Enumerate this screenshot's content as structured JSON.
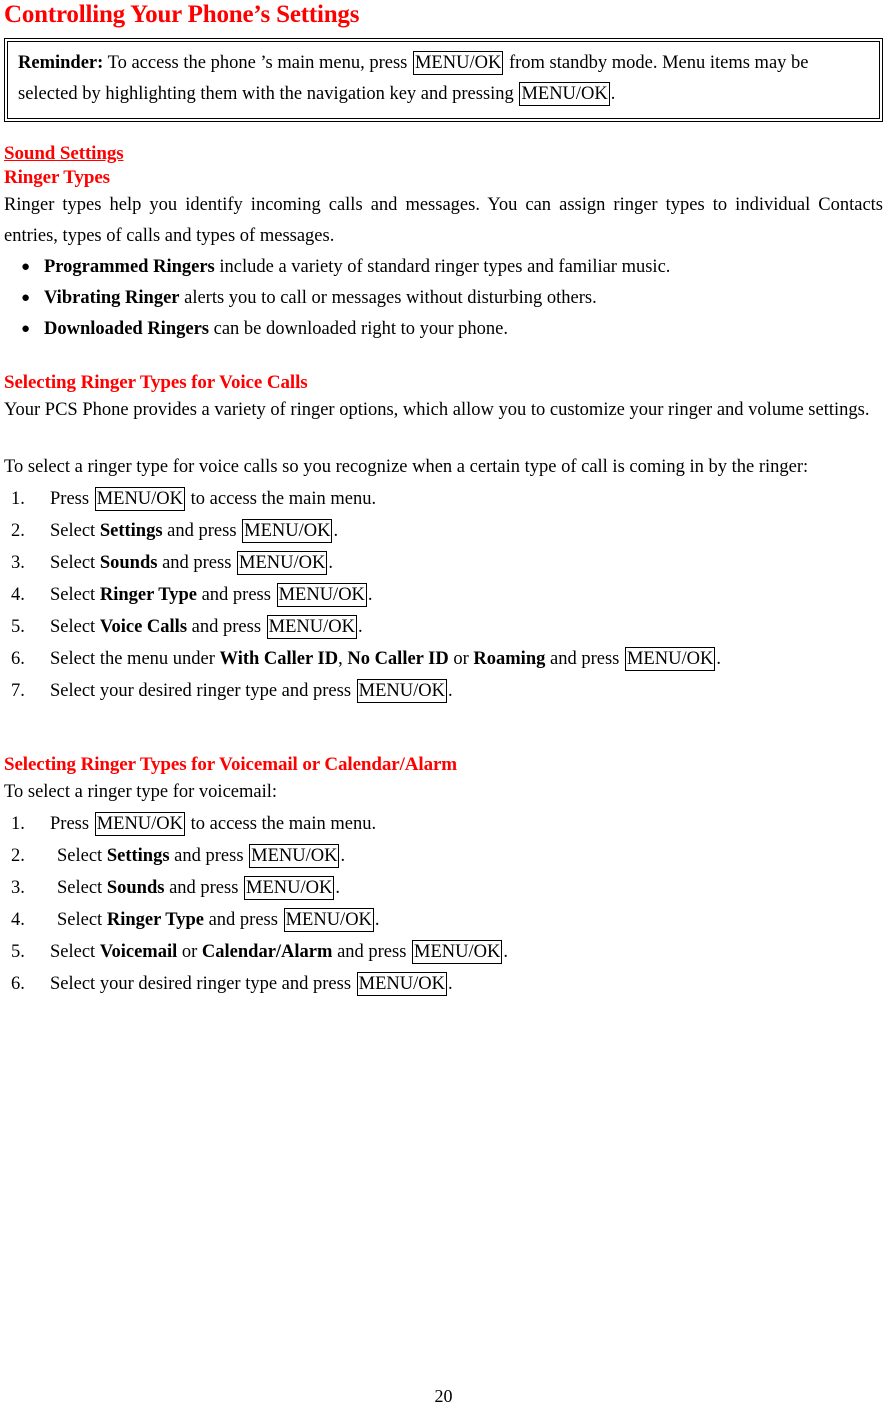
{
  "document": {
    "title": "Controlling Your Phone’s Settings",
    "page_number": "20",
    "accent_color": "#FF0000",
    "text_color": "#000000"
  },
  "reminder": {
    "label": "Reminder:",
    "part1": " To access the phone ’s main menu, press ",
    "key1": "MENU/OK",
    "part2": " from standby mode. Menu items may be selected by highlighting them with the navigation key and pressing ",
    "key2": "MENU/OK",
    "part3": "."
  },
  "sound_settings": {
    "heading": "Sound Settings",
    "ringer_types": {
      "heading": "Ringer Types",
      "intro": "Ringer types help you identify incoming calls and messages. You can assign ringer types to individual Contacts entries, types of calls and types of messages.",
      "bullets": [
        {
          "bullet": "●",
          "bold": "Programmed Ringers",
          "rest": " include a variety of standard ringer types and familiar music."
        },
        {
          "bullet": "●",
          "bold": "Vibrating Ringer",
          "rest": " alerts you to call or messages without disturbing others."
        },
        {
          "bullet": "●",
          "bold": "Downloaded Ringers",
          "rest": " can be downloaded right to your phone."
        }
      ]
    }
  },
  "voice_calls_section": {
    "heading": "Selecting Ringer Types for Voice Calls",
    "paragraph": "Your PCS Phone provides a variety of ringer options, which allow you to customize your ringer and volume settings.",
    "lead_in": "To select a ringer type for voice calls so you recognize when a certain type of call is coming in by the ringer:",
    "steps": [
      {
        "num": "1.",
        "pre": "Press ",
        "key": "MENU/OK",
        "post": " to access the main menu."
      },
      {
        "num": "2.",
        "pre": "Select ",
        "bold1": "Settings",
        "mid": " and press ",
        "key": "MENU/OK",
        "post": "."
      },
      {
        "num": "3.",
        "pre": "Select ",
        "bold1": "Sounds",
        "mid": " and press ",
        "key": "MENU/OK",
        "post": "."
      },
      {
        "num": "4.",
        "pre": "Select ",
        "bold1": "Ringer Type",
        "mid": " and press ",
        "key": "MENU/OK",
        "post": "."
      },
      {
        "num": "5.",
        "pre": "Select ",
        "bold1": "Voice Calls",
        "mid": " and press ",
        "key": "MENU/OK",
        "post": "."
      },
      {
        "num": "6.",
        "pre": "Select the menu under ",
        "bold1": "With Caller ID",
        "sep1": ", ",
        "bold2": "No Caller ID",
        "sep2": " or ",
        "bold3": "Roaming",
        "mid": " and press ",
        "key": "MENU/OK",
        "post": "."
      },
      {
        "num": "7.",
        "pre": "Select your desired ringer type and press ",
        "key": "MENU/OK",
        "post": "."
      }
    ]
  },
  "voicemail_section": {
    "heading": "Selecting Ringer Types for Voicemail or Calendar/Alarm",
    "lead_in": "To select a ringer type for voicemail:",
    "steps": [
      {
        "num": "1.",
        "pre": "Press ",
        "key": "MENU/OK",
        "post": " to access the main menu."
      },
      {
        "num": "2.",
        "pre": "Select ",
        "bold1": "Settings",
        "mid": " and press ",
        "key": "MENU/OK",
        "post": "."
      },
      {
        "num": "3.",
        "pre": "Select ",
        "bold1": "Sounds",
        "mid": " and press ",
        "key": "MENU/OK",
        "post": "."
      },
      {
        "num": "4.",
        "pre": "Select ",
        "bold1": "Ringer Type",
        "mid": " and press ",
        "key": "MENU/OK",
        "post": "."
      },
      {
        "num": "5.",
        "pre": "Select ",
        "bold1": "Voicemail",
        "sep2": " or ",
        "bold2": "Calendar/Alarm",
        "mid": " and press ",
        "key": "MENU/OK",
        "post": "."
      },
      {
        "num": "6.",
        "pre": "Select your desired ringer type and press ",
        "key": "MENU/OK",
        "post": "."
      }
    ]
  }
}
